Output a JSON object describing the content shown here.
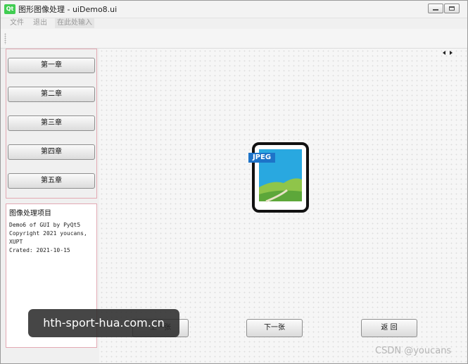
{
  "window": {
    "title": "图形图像处理 - uiDemo8.ui",
    "app_icon": "Qt",
    "icon_names": [
      "qt-logo-icon",
      "minimize-icon",
      "maximize-icon"
    ]
  },
  "menubar": {
    "items": [
      "文件",
      "退出",
      "在此处输入"
    ]
  },
  "nav": {
    "buttons": [
      "第一章",
      "第二章",
      "第三章",
      "第四章",
      "第五章"
    ]
  },
  "info": {
    "title": "图像处理项目",
    "lines": [
      "Demo6 of GUI by PyQt5",
      "Copyright 2021 youcans,",
      "XUPT",
      "Crated: 2021-10-15"
    ]
  },
  "viewer": {
    "image_label": "JPEG",
    "image_icon": "jpeg-file-icon",
    "scroll_icons": [
      "scroll-left-icon",
      "scroll-right-icon"
    ]
  },
  "buttons": {
    "prev": "上一张",
    "next": "下一张",
    "back": "返 回"
  },
  "overlay": {
    "text": "hth-sport-hua.com.cn"
  },
  "watermark": {
    "text": "CSDN @youcans"
  },
  "colors": {
    "panel_border": "#e3a9b3",
    "jpeg_badge": "#1d73c8",
    "qt_green": "#41cd52"
  }
}
